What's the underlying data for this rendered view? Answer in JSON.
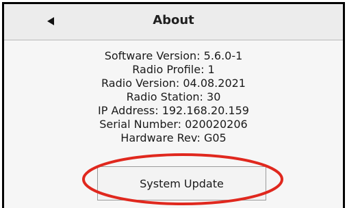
{
  "header": {
    "back_icon": "back-arrow-icon",
    "title": "About"
  },
  "info": {
    "software_version": "Software Version: 5.6.0-1",
    "radio_profile": "Radio Profile: 1",
    "radio_version": "Radio Version: 04.08.2021",
    "radio_station": "Radio Station: 30",
    "ip_address": "IP Address: 192.168.20.159",
    "serial_number": "Serial Number: 020020206",
    "hardware_rev": "Hardware Rev: G05"
  },
  "actions": {
    "system_update_label": "System Update"
  },
  "colors": {
    "highlight": "#e0281e",
    "header_bg": "#ececec",
    "screen_bg": "#f6f6f6"
  }
}
